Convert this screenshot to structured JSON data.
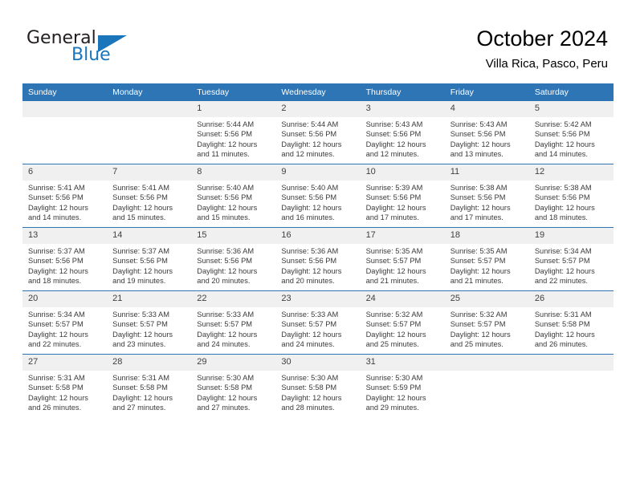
{
  "brand": {
    "name_top": "General",
    "name_bottom": "Blue",
    "accent_color": "#1b75bb",
    "triangle_icon": "blue-triangle-icon"
  },
  "header": {
    "title": "October 2024",
    "subtitle": "Villa Rica, Pasco, Peru"
  },
  "calendar": {
    "header_bg": "#2e75b6",
    "daynum_bg": "#f0f0f0",
    "weekdays": [
      "Sunday",
      "Monday",
      "Tuesday",
      "Wednesday",
      "Thursday",
      "Friday",
      "Saturday"
    ],
    "weeks": [
      [
        {
          "day": "",
          "sunrise": "",
          "sunset": "",
          "daylight_1": "",
          "daylight_2": ""
        },
        {
          "day": "",
          "sunrise": "",
          "sunset": "",
          "daylight_1": "",
          "daylight_2": ""
        },
        {
          "day": "1",
          "sunrise": "Sunrise: 5:44 AM",
          "sunset": "Sunset: 5:56 PM",
          "daylight_1": "Daylight: 12 hours",
          "daylight_2": "and 11 minutes."
        },
        {
          "day": "2",
          "sunrise": "Sunrise: 5:44 AM",
          "sunset": "Sunset: 5:56 PM",
          "daylight_1": "Daylight: 12 hours",
          "daylight_2": "and 12 minutes."
        },
        {
          "day": "3",
          "sunrise": "Sunrise: 5:43 AM",
          "sunset": "Sunset: 5:56 PM",
          "daylight_1": "Daylight: 12 hours",
          "daylight_2": "and 12 minutes."
        },
        {
          "day": "4",
          "sunrise": "Sunrise: 5:43 AM",
          "sunset": "Sunset: 5:56 PM",
          "daylight_1": "Daylight: 12 hours",
          "daylight_2": "and 13 minutes."
        },
        {
          "day": "5",
          "sunrise": "Sunrise: 5:42 AM",
          "sunset": "Sunset: 5:56 PM",
          "daylight_1": "Daylight: 12 hours",
          "daylight_2": "and 14 minutes."
        }
      ],
      [
        {
          "day": "6",
          "sunrise": "Sunrise: 5:41 AM",
          "sunset": "Sunset: 5:56 PM",
          "daylight_1": "Daylight: 12 hours",
          "daylight_2": "and 14 minutes."
        },
        {
          "day": "7",
          "sunrise": "Sunrise: 5:41 AM",
          "sunset": "Sunset: 5:56 PM",
          "daylight_1": "Daylight: 12 hours",
          "daylight_2": "and 15 minutes."
        },
        {
          "day": "8",
          "sunrise": "Sunrise: 5:40 AM",
          "sunset": "Sunset: 5:56 PM",
          "daylight_1": "Daylight: 12 hours",
          "daylight_2": "and 15 minutes."
        },
        {
          "day": "9",
          "sunrise": "Sunrise: 5:40 AM",
          "sunset": "Sunset: 5:56 PM",
          "daylight_1": "Daylight: 12 hours",
          "daylight_2": "and 16 minutes."
        },
        {
          "day": "10",
          "sunrise": "Sunrise: 5:39 AM",
          "sunset": "Sunset: 5:56 PM",
          "daylight_1": "Daylight: 12 hours",
          "daylight_2": "and 17 minutes."
        },
        {
          "day": "11",
          "sunrise": "Sunrise: 5:38 AM",
          "sunset": "Sunset: 5:56 PM",
          "daylight_1": "Daylight: 12 hours",
          "daylight_2": "and 17 minutes."
        },
        {
          "day": "12",
          "sunrise": "Sunrise: 5:38 AM",
          "sunset": "Sunset: 5:56 PM",
          "daylight_1": "Daylight: 12 hours",
          "daylight_2": "and 18 minutes."
        }
      ],
      [
        {
          "day": "13",
          "sunrise": "Sunrise: 5:37 AM",
          "sunset": "Sunset: 5:56 PM",
          "daylight_1": "Daylight: 12 hours",
          "daylight_2": "and 18 minutes."
        },
        {
          "day": "14",
          "sunrise": "Sunrise: 5:37 AM",
          "sunset": "Sunset: 5:56 PM",
          "daylight_1": "Daylight: 12 hours",
          "daylight_2": "and 19 minutes."
        },
        {
          "day": "15",
          "sunrise": "Sunrise: 5:36 AM",
          "sunset": "Sunset: 5:56 PM",
          "daylight_1": "Daylight: 12 hours",
          "daylight_2": "and 20 minutes."
        },
        {
          "day": "16",
          "sunrise": "Sunrise: 5:36 AM",
          "sunset": "Sunset: 5:56 PM",
          "daylight_1": "Daylight: 12 hours",
          "daylight_2": "and 20 minutes."
        },
        {
          "day": "17",
          "sunrise": "Sunrise: 5:35 AM",
          "sunset": "Sunset: 5:57 PM",
          "daylight_1": "Daylight: 12 hours",
          "daylight_2": "and 21 minutes."
        },
        {
          "day": "18",
          "sunrise": "Sunrise: 5:35 AM",
          "sunset": "Sunset: 5:57 PM",
          "daylight_1": "Daylight: 12 hours",
          "daylight_2": "and 21 minutes."
        },
        {
          "day": "19",
          "sunrise": "Sunrise: 5:34 AM",
          "sunset": "Sunset: 5:57 PM",
          "daylight_1": "Daylight: 12 hours",
          "daylight_2": "and 22 minutes."
        }
      ],
      [
        {
          "day": "20",
          "sunrise": "Sunrise: 5:34 AM",
          "sunset": "Sunset: 5:57 PM",
          "daylight_1": "Daylight: 12 hours",
          "daylight_2": "and 22 minutes."
        },
        {
          "day": "21",
          "sunrise": "Sunrise: 5:33 AM",
          "sunset": "Sunset: 5:57 PM",
          "daylight_1": "Daylight: 12 hours",
          "daylight_2": "and 23 minutes."
        },
        {
          "day": "22",
          "sunrise": "Sunrise: 5:33 AM",
          "sunset": "Sunset: 5:57 PM",
          "daylight_1": "Daylight: 12 hours",
          "daylight_2": "and 24 minutes."
        },
        {
          "day": "23",
          "sunrise": "Sunrise: 5:33 AM",
          "sunset": "Sunset: 5:57 PM",
          "daylight_1": "Daylight: 12 hours",
          "daylight_2": "and 24 minutes."
        },
        {
          "day": "24",
          "sunrise": "Sunrise: 5:32 AM",
          "sunset": "Sunset: 5:57 PM",
          "daylight_1": "Daylight: 12 hours",
          "daylight_2": "and 25 minutes."
        },
        {
          "day": "25",
          "sunrise": "Sunrise: 5:32 AM",
          "sunset": "Sunset: 5:57 PM",
          "daylight_1": "Daylight: 12 hours",
          "daylight_2": "and 25 minutes."
        },
        {
          "day": "26",
          "sunrise": "Sunrise: 5:31 AM",
          "sunset": "Sunset: 5:58 PM",
          "daylight_1": "Daylight: 12 hours",
          "daylight_2": "and 26 minutes."
        }
      ],
      [
        {
          "day": "27",
          "sunrise": "Sunrise: 5:31 AM",
          "sunset": "Sunset: 5:58 PM",
          "daylight_1": "Daylight: 12 hours",
          "daylight_2": "and 26 minutes."
        },
        {
          "day": "28",
          "sunrise": "Sunrise: 5:31 AM",
          "sunset": "Sunset: 5:58 PM",
          "daylight_1": "Daylight: 12 hours",
          "daylight_2": "and 27 minutes."
        },
        {
          "day": "29",
          "sunrise": "Sunrise: 5:30 AM",
          "sunset": "Sunset: 5:58 PM",
          "daylight_1": "Daylight: 12 hours",
          "daylight_2": "and 27 minutes."
        },
        {
          "day": "30",
          "sunrise": "Sunrise: 5:30 AM",
          "sunset": "Sunset: 5:58 PM",
          "daylight_1": "Daylight: 12 hours",
          "daylight_2": "and 28 minutes."
        },
        {
          "day": "31",
          "sunrise": "Sunrise: 5:30 AM",
          "sunset": "Sunset: 5:59 PM",
          "daylight_1": "Daylight: 12 hours",
          "daylight_2": "and 29 minutes."
        },
        {
          "day": "",
          "sunrise": "",
          "sunset": "",
          "daylight_1": "",
          "daylight_2": ""
        },
        {
          "day": "",
          "sunrise": "",
          "sunset": "",
          "daylight_1": "",
          "daylight_2": ""
        }
      ]
    ]
  }
}
